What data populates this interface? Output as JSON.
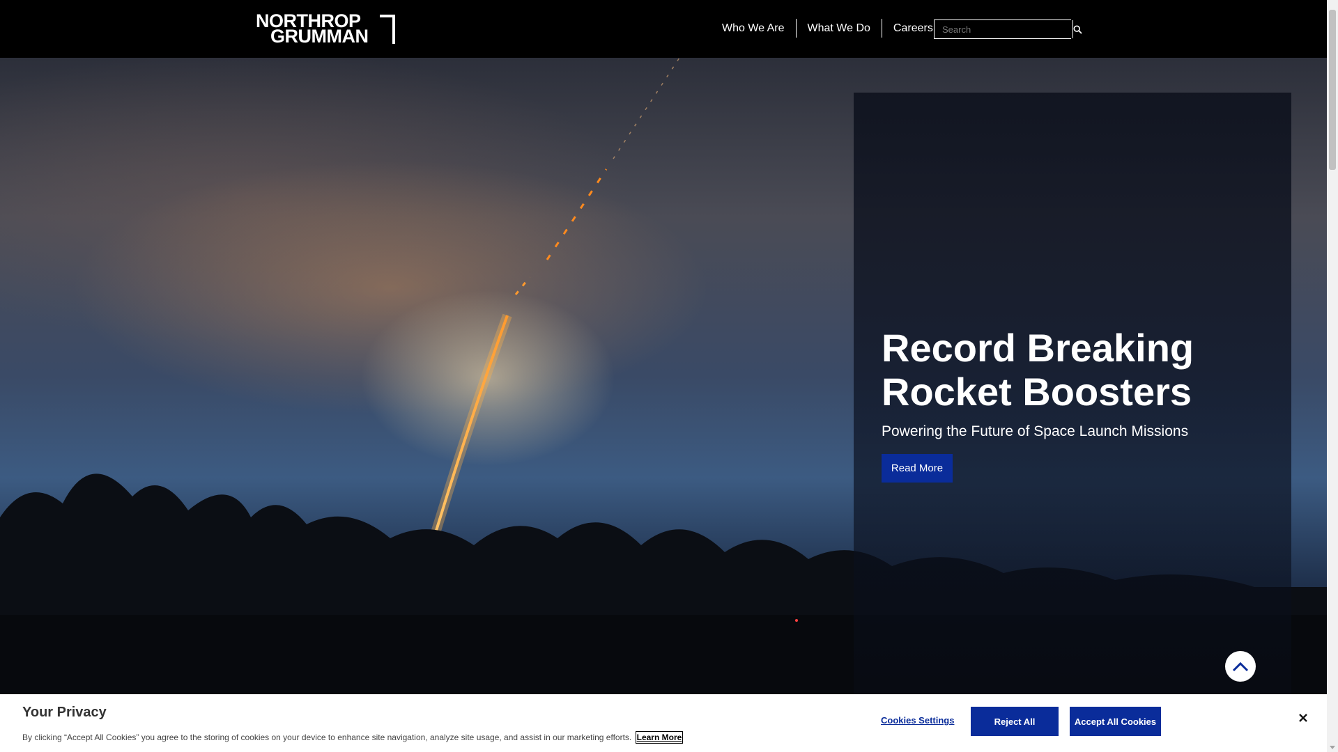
{
  "header": {
    "logo_line1": "NORTHROP",
    "logo_line2": "GRUMMAN",
    "nav": [
      {
        "label": "Who We Are"
      },
      {
        "label": "What We Do"
      },
      {
        "label": "Careers"
      }
    ],
    "search": {
      "placeholder": "Search",
      "icon": "search-icon"
    }
  },
  "hero": {
    "headline": "Record Breaking Rocket Boosters",
    "subhead": "Powering the Future of Space Launch Missions",
    "cta_label": "Read More",
    "cta_color": "#0a2c9a",
    "scroll_top_icon": "chevron-up-icon"
  },
  "cookie_banner": {
    "title": "Your Privacy",
    "text": "By clicking “Accept All Cookies” you agree to the storing of cookies on your device to enhance site navigation, analyze site usage, and assist in our marketing efforts.",
    "learn_more": "Learn More",
    "settings_label": "Cookies Settings",
    "reject_label": "Reject All",
    "accept_label": "Accept All Cookies",
    "close_icon": "close-icon"
  }
}
